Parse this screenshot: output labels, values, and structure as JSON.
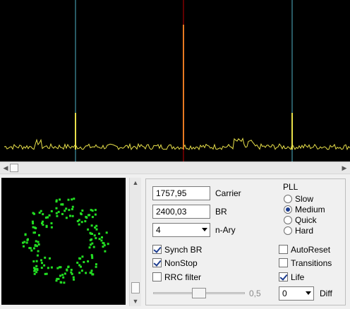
{
  "spectrum": {
    "icon": "spectrum-display",
    "marker_colors": {
      "center": "#c00000",
      "side": "#4fb3c8",
      "trace": "#e8e04a"
    }
  },
  "constellation": {
    "icon": "constellation-display",
    "dot_color": "#22dd22"
  },
  "controls": {
    "carrier": {
      "value": "1757,95",
      "label": "Carrier"
    },
    "br": {
      "value": "2400,03",
      "label": "BR"
    },
    "nary": {
      "selected": "4",
      "label": "n-Ary"
    },
    "synch_br": {
      "label": "Synch BR",
      "checked": true
    },
    "nonstop": {
      "label": "NonStop",
      "checked": true
    },
    "rrc_filter": {
      "label": "RRC filter",
      "checked": false
    },
    "autoreset": {
      "label": "AutoReset",
      "checked": false
    },
    "transitions": {
      "label": "Transitions",
      "checked": false
    },
    "life": {
      "label": "Life",
      "checked": true
    },
    "slider_value": "0,5",
    "diff": {
      "selected": "0",
      "label": "Diff"
    },
    "pll": {
      "title": "PLL",
      "options": [
        {
          "label": "Slow",
          "selected": false
        },
        {
          "label": "Medium",
          "selected": true
        },
        {
          "label": "Quick",
          "selected": false
        },
        {
          "label": "Hard",
          "selected": false
        }
      ]
    }
  }
}
